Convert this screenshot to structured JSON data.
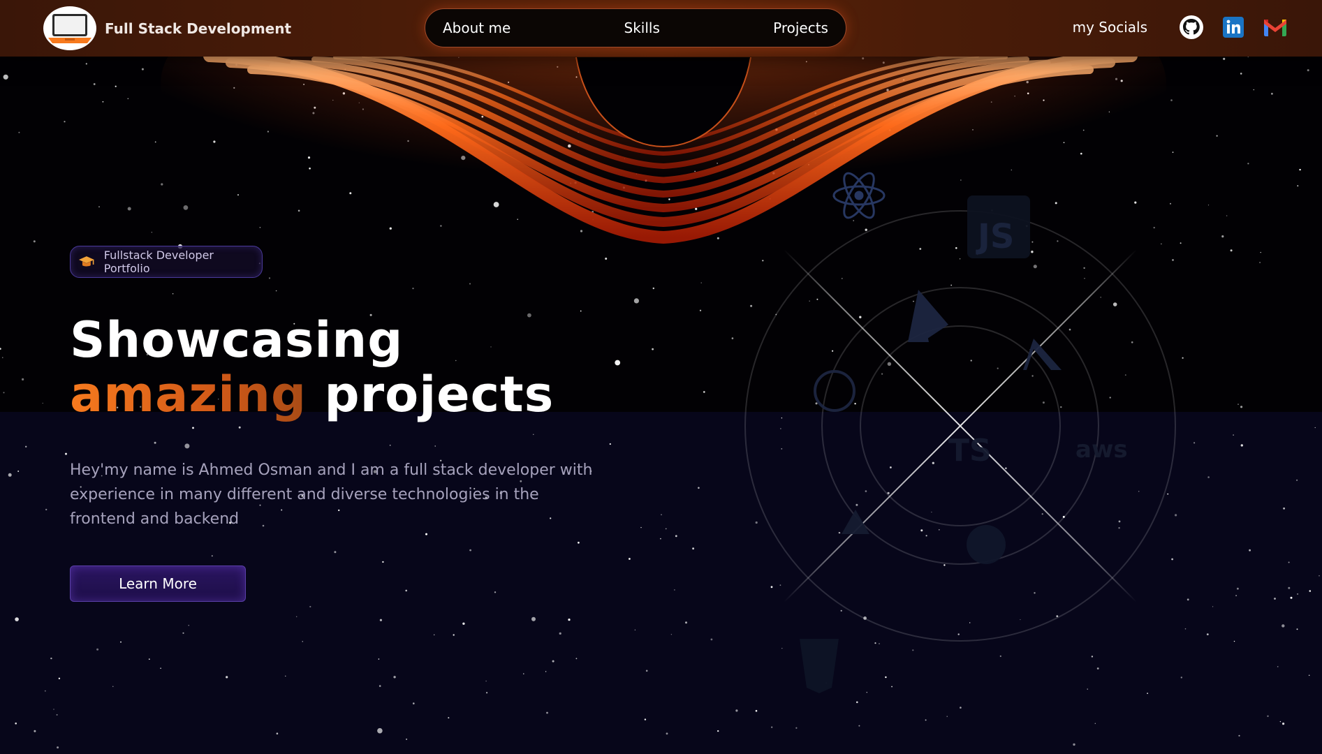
{
  "header": {
    "brand_name": "Full Stack Development",
    "nav": [
      {
        "label": "About me"
      },
      {
        "label": "Skills"
      },
      {
        "label": "Projects"
      }
    ],
    "socials_label": "my Socials",
    "social_icons": [
      "github-icon",
      "linkedin-icon",
      "gmail-icon"
    ]
  },
  "hero": {
    "badge": "Fullstack Developer Portfolio",
    "headline_line1": "Showcasing",
    "headline_accent": "amazing",
    "headline_rest": "projects",
    "intro": "Hey'my name is Ahmed Osman and I am a full stack developer with experience in many different and diverse technologies in the frontend and backend",
    "cta": "Learn More"
  },
  "skills_wheel": {
    "icons": [
      "react-icon",
      "javascript-icon",
      "firebase-icon",
      "openai-icon",
      "typescript-icon",
      "tailwind-icon",
      "aws-icon",
      "vercel-icon",
      "github-icon",
      "html5-icon"
    ],
    "js_label": "JS",
    "ts_label": "TS",
    "aws_label": "aws"
  },
  "colors": {
    "accent_orange": "#f77a1e",
    "header_bg": "#4a1c08",
    "nav_border": "#a04a2a",
    "button_purple": "#2a1560",
    "page_bottom": "#07061a"
  }
}
